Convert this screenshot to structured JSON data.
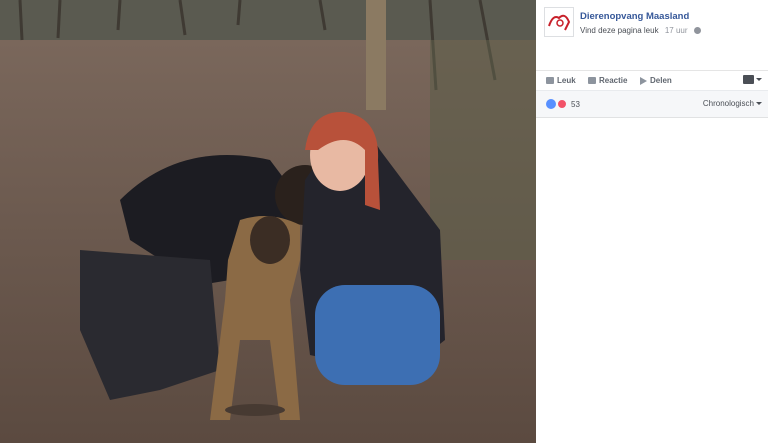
{
  "page": {
    "name": "Dierenopvang Maasland",
    "follow_text": "Vind deze pagina leuk",
    "time": "17 uur"
  },
  "actions": {
    "like": "Leuk",
    "comment": "Reactie",
    "share": "Delen"
  },
  "reactions": {
    "count": "53",
    "sort": "Chronologisch"
  },
  "icons": [
    "logo-icon",
    "globe-icon",
    "like-icon",
    "comment-icon",
    "share-icon",
    "audience-icon",
    "like-reaction-icon",
    "love-reaction-icon"
  ],
  "colors": {
    "link": "#365899",
    "like": "#5890ff",
    "love": "#f25268"
  }
}
